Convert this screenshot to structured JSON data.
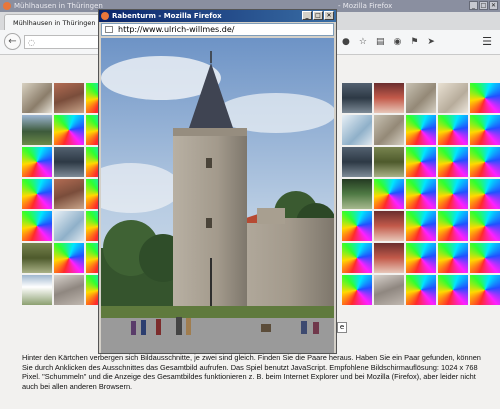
{
  "browser": {
    "window_title": "Mühlhausen in Thüringen",
    "window_title_suffix": "- Mozilla Firefox",
    "tab_label": "Mühlhausen in Thüringen"
  },
  "popup": {
    "title": "Rabenturm - Mozilla Firefox",
    "url": "http://www.ulrich-willmes.de/",
    "button_stub": "e"
  },
  "description": "Hinter den Kärtchen verbergen sich Bildausschnitte, je zwei sind gleich. Finden Sie die Paare heraus. Haben Sie ein Paar gefunden, können Sie durch Anklicken des Ausschnittes das Gesamtbild aufrufen. Das Spiel benutzt JavaScript. Empfohlene Bildschirmauflösung: 1024 x 768 Pixel. \"Schummeln\" und die Anzeige des Gesamtbildes funktionieren z. B. beim Internet Explorer und bei Mozilla (Firefox), aber leider nicht auch bei allen anderen Browsern.",
  "grid": {
    "tiles": [
      "ph-a",
      "ph-b",
      "rb",
      "gap",
      "gap",
      "gap",
      "gap",
      "gap",
      "gap",
      "gap",
      "ph-h",
      "ph-j",
      "ph-l",
      "ph-i",
      "rb",
      "ph-c",
      "rb",
      "rb",
      "gap",
      "gap",
      "gap",
      "gap",
      "gap",
      "gap",
      "gap",
      "ph-e",
      "ph-l",
      "rb",
      "rb",
      "rb",
      "rb",
      "ph-h",
      "rb",
      "gap",
      "gap",
      "gap",
      "gap",
      "gap",
      "gap",
      "gap",
      "ph-h",
      "ph-d",
      "rb",
      "rb",
      "rb",
      "rb",
      "ph-b",
      "rb",
      "gap",
      "gap",
      "gap",
      "gap",
      "gap",
      "gap",
      "gap",
      "ph-k",
      "rb",
      "rb",
      "rb",
      "rb",
      "rb",
      "ph-e",
      "rb",
      "gap",
      "gap",
      "gap",
      "gap",
      "gap",
      "gap",
      "gap",
      "rb",
      "ph-j",
      "rb",
      "rb",
      "rb",
      "ph-d",
      "rb",
      "rb",
      "gap",
      "gap",
      "gap",
      "gap",
      "gap",
      "gap",
      "gap",
      "rb",
      "ph-j",
      "rb",
      "rb",
      "rb",
      "ph-f",
      "ph-g",
      "rb",
      "gap",
      "gap",
      "gap",
      "gap",
      "gap",
      "gap",
      "gap",
      "rb",
      "ph-g",
      "rb",
      "rb",
      "rb"
    ]
  },
  "icons": {
    "back": "back-arrow-icon",
    "toolbar": [
      "chat-icon",
      "star-icon",
      "clipboard-icon",
      "pocket-icon",
      "shield-icon",
      "send-icon"
    ],
    "menu": "hamburger-menu-icon"
  },
  "colors": {
    "popup_title_start": "#0a246a",
    "popup_title_end": "#3a6ea5",
    "page_bg": "#f2f1ef"
  }
}
